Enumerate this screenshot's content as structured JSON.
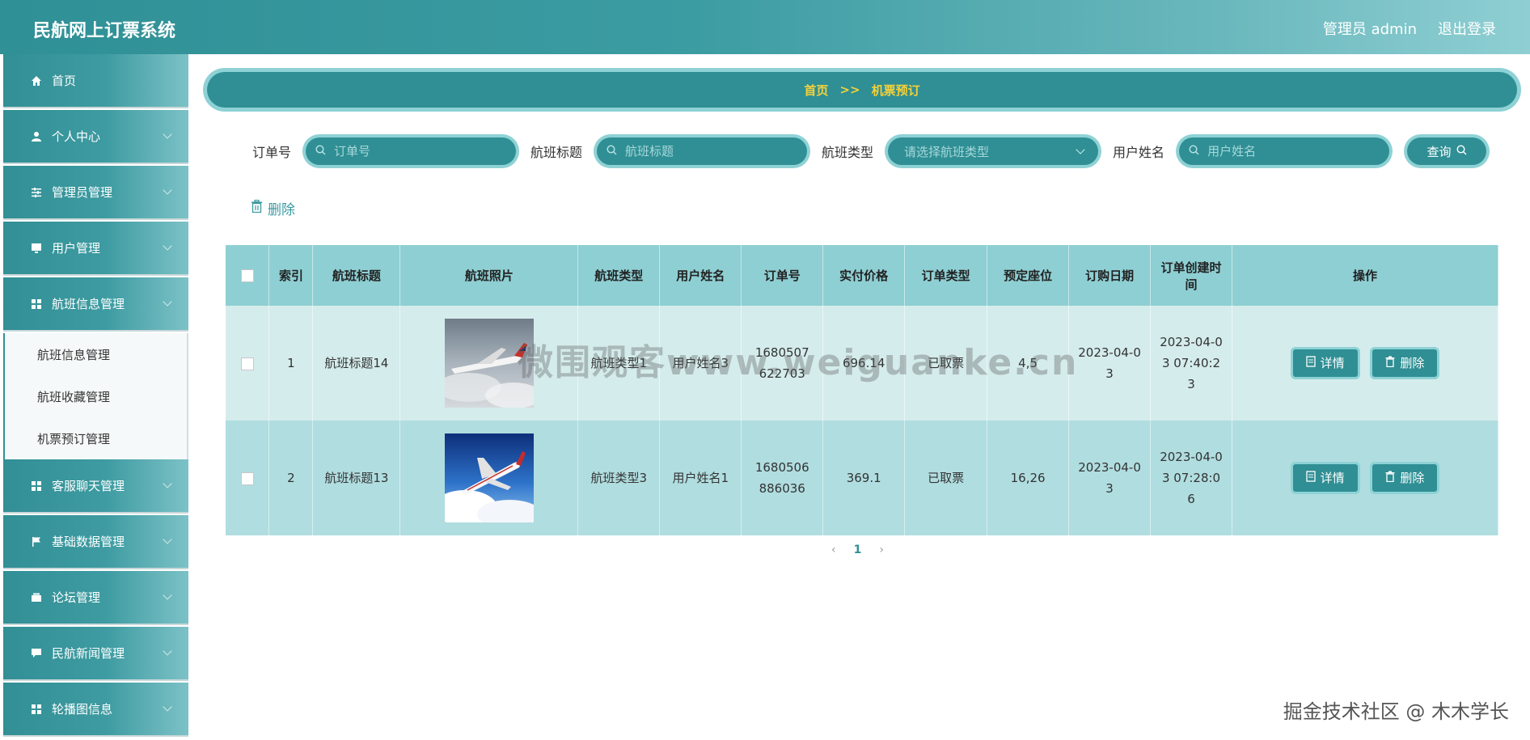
{
  "header": {
    "title": "民航网上订票系统",
    "user": "管理员 admin",
    "logout": "退出登录"
  },
  "sidebar": {
    "items": [
      {
        "label": "首页",
        "icon": "home-icon"
      },
      {
        "label": "个人中心",
        "icon": "user-icon"
      },
      {
        "label": "管理员管理",
        "icon": "sliders-icon"
      },
      {
        "label": "用户管理",
        "icon": "monitor-icon"
      },
      {
        "label": "航班信息管理",
        "icon": "grid-icon"
      }
    ],
    "submenu": [
      "航班信息管理",
      "航班收藏管理",
      "机票预订管理"
    ],
    "items_after": [
      {
        "label": "客服聊天管理",
        "icon": "grid-icon"
      },
      {
        "label": "基础数据管理",
        "icon": "flag-icon"
      },
      {
        "label": "论坛管理",
        "icon": "wallet-icon"
      },
      {
        "label": "民航新闻管理",
        "icon": "chat-icon"
      },
      {
        "label": "轮播图信息",
        "icon": "grid-icon"
      }
    ]
  },
  "breadcrumb": {
    "home": "首页",
    "sep": ">>",
    "current": "机票预订"
  },
  "search": {
    "order_label": "订单号",
    "order_placeholder": "订单号",
    "title_label": "航班标题",
    "title_placeholder": "航班标题",
    "type_label": "航班类型",
    "type_placeholder": "请选择航班类型",
    "user_label": "用户姓名",
    "user_placeholder": "用户姓名",
    "query_button": "查询"
  },
  "toolbar": {
    "delete": "删除"
  },
  "table": {
    "headers": [
      "索引",
      "航班标题",
      "航班照片",
      "航班类型",
      "用户姓名",
      "订单号",
      "实付价格",
      "订单类型",
      "预定座位",
      "订购日期",
      "订单创建时间",
      "操作"
    ],
    "rows": [
      {
        "index": "1",
        "title": "航班标题14",
        "type": "航班类型1",
        "user": "用户姓名3",
        "order": "1680507622703",
        "price": "696.14",
        "order_type": "已取票",
        "seat": "4,5",
        "date": "2023-04-03",
        "created": "2023-04-03 07:40:23"
      },
      {
        "index": "2",
        "title": "航班标题13",
        "type": "航班类型3",
        "user": "用户姓名1",
        "order": "1680506886036",
        "price": "369.1",
        "order_type": "已取票",
        "seat": "16,26",
        "date": "2023-04-03",
        "created": "2023-04-03 07:28:06"
      }
    ],
    "detail_btn": "详情",
    "delete_btn": "删除"
  },
  "pagination": {
    "prev": "‹",
    "current": "1",
    "next": "›"
  },
  "watermark": "微围观客www.weiguanke.cn",
  "footer_watermark": "掘金技术社区 @ 木木学长"
}
